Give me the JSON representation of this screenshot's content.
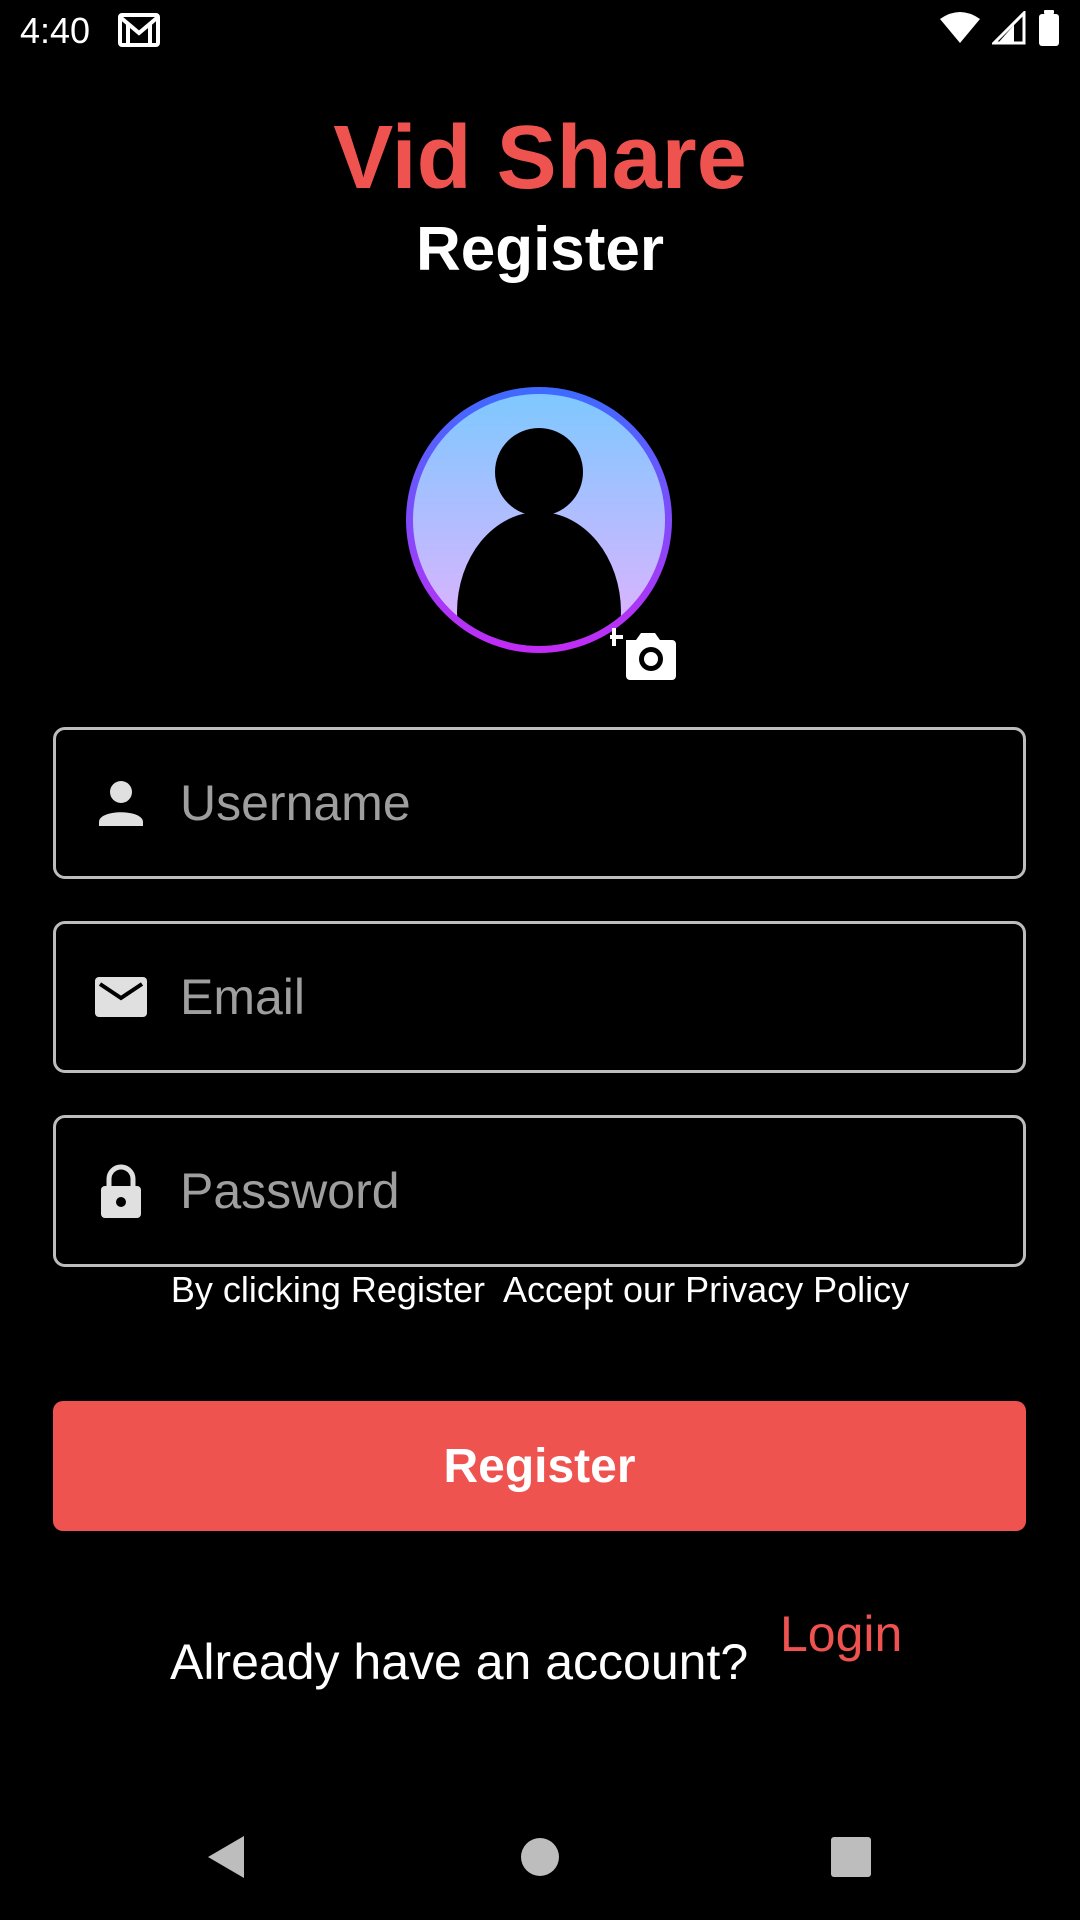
{
  "status_bar": {
    "time": "4:40",
    "icons": [
      "gmail-icon",
      "wifi-icon",
      "signal-icon",
      "battery-icon"
    ]
  },
  "app": {
    "title": "Vid Share",
    "page_title": "Register",
    "accent_color": "#EF5350"
  },
  "avatar": {
    "icon": "person-avatar-icon",
    "add_photo_icon": "add-a-photo-icon"
  },
  "form": {
    "username": {
      "placeholder": "Username",
      "value": "",
      "icon": "person-icon"
    },
    "email": {
      "placeholder": "Email",
      "value": "",
      "icon": "mail-icon"
    },
    "password": {
      "placeholder": "Password",
      "value": "",
      "icon": "lock-icon"
    }
  },
  "terms_text": "By clicking Register  Accept our Privacy Policy",
  "register_button": "Register",
  "footer": {
    "prompt": "Already have an account?",
    "login_link": "Login"
  },
  "nav_bar": {
    "icons": [
      "back-icon",
      "home-icon",
      "recents-icon"
    ]
  }
}
